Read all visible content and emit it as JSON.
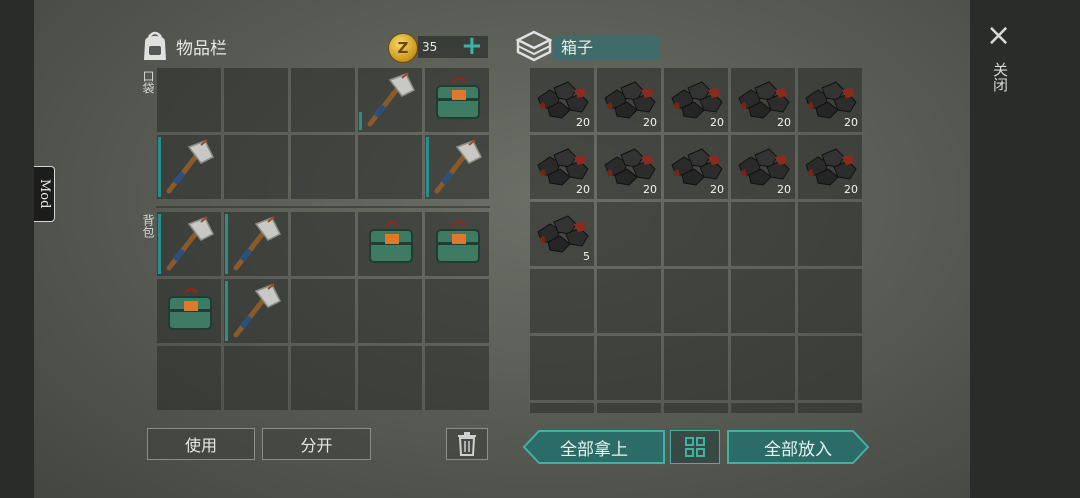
{
  "mod_tab": "Mod",
  "inventory": {
    "title": "物品栏",
    "coins": "35",
    "plus": "+",
    "pocket_label": "口袋",
    "backpack_label": "背包",
    "pocket": [
      [
        "",
        "",
        "",
        "hammer",
        "tackle-box"
      ],
      [
        "hammer",
        "",
        "",
        "",
        "hammer"
      ]
    ],
    "backpack": [
      [
        "hammer",
        "hammer",
        "",
        "tackle-box",
        "tackle-box"
      ],
      [
        "tackle-box",
        "hammer",
        "",
        "",
        ""
      ],
      [
        "",
        "",
        "",
        "",
        ""
      ]
    ]
  },
  "box": {
    "title": "箱子",
    "items": [
      {
        "icon": "coal",
        "qty": "20"
      },
      {
        "icon": "coal",
        "qty": "20"
      },
      {
        "icon": "coal",
        "qty": "20"
      },
      {
        "icon": "coal",
        "qty": "20"
      },
      {
        "icon": "coal",
        "qty": "20"
      },
      {
        "icon": "coal",
        "qty": "20"
      },
      {
        "icon": "coal",
        "qty": "20"
      },
      {
        "icon": "coal",
        "qty": "20"
      },
      {
        "icon": "coal",
        "qty": "20"
      },
      {
        "icon": "coal",
        "qty": "20"
      },
      {
        "icon": "coal",
        "qty": "5"
      }
    ]
  },
  "buttons": {
    "use": "使用",
    "split": "分开",
    "take_all": "全部拿上",
    "put_all": "全部放入"
  },
  "close": {
    "label": "关闭",
    "icon": "×"
  },
  "colors": {
    "accent": "#3fb2a4",
    "box_title_bg": "#3f6c6a"
  }
}
